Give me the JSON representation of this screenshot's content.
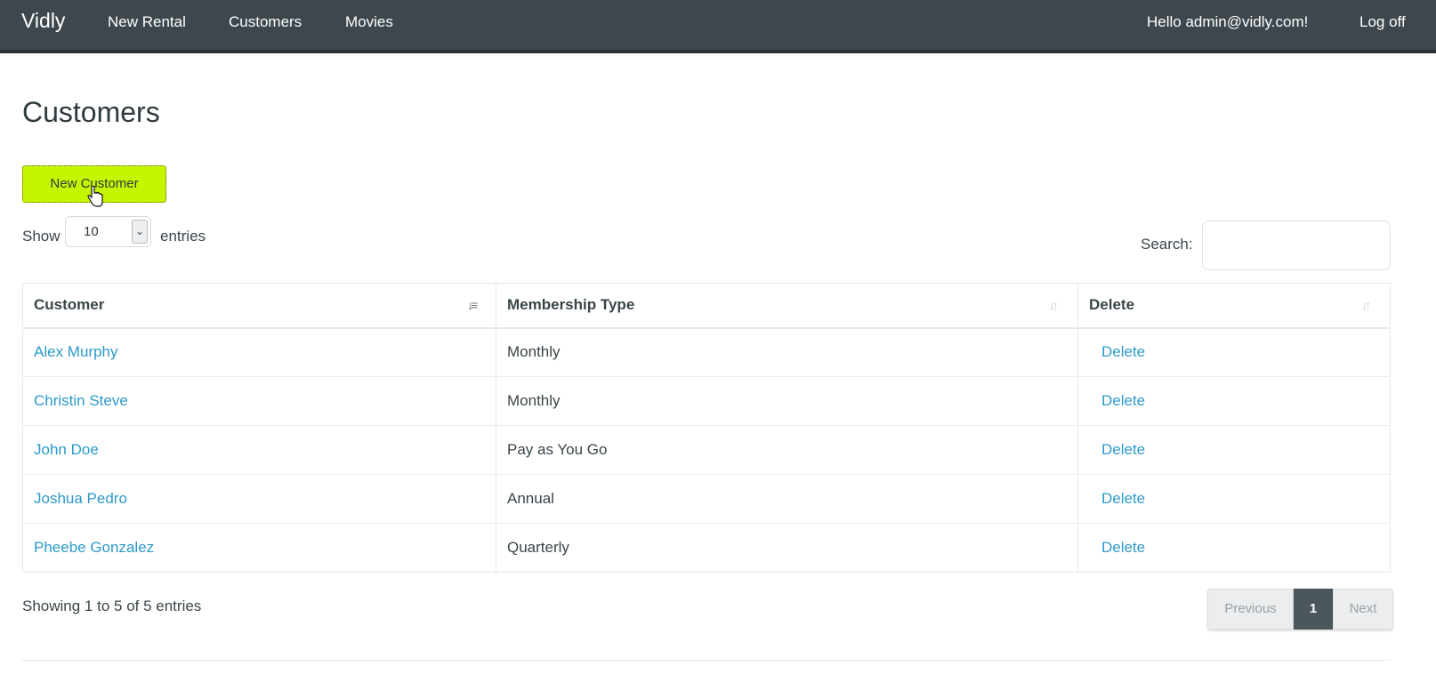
{
  "navbar": {
    "brand": "Vidly",
    "links": [
      "New Rental",
      "Customers",
      "Movies"
    ],
    "greeting": "Hello admin@vidly.com!",
    "logoff": "Log off"
  },
  "page": {
    "title": "Customers",
    "new_button": "New Customer"
  },
  "length": {
    "show_label": "Show",
    "selected": "10",
    "entries_label": "entries"
  },
  "search": {
    "label": "Search:",
    "value": ""
  },
  "table": {
    "headers": [
      "Customer",
      "Membership Type",
      "Delete"
    ],
    "rows": [
      {
        "customer": "Alex Murphy",
        "membership": "Monthly",
        "action": "Delete"
      },
      {
        "customer": "Christin Steve",
        "membership": "Monthly",
        "action": "Delete"
      },
      {
        "customer": "John Doe",
        "membership": "Pay as You Go",
        "action": "Delete"
      },
      {
        "customer": "Joshua Pedro",
        "membership": "Annual",
        "action": "Delete"
      },
      {
        "customer": "Pheebe Gonzalez",
        "membership": "Quarterly",
        "action": "Delete"
      }
    ]
  },
  "footer": {
    "info": "Showing 1 to 5 of 5 entries",
    "previous": "Previous",
    "current_page": "1",
    "next": "Next"
  },
  "colors": {
    "navbar": "#3e474d",
    "accent_button": "#c6f500",
    "link": "#2c9ac9",
    "active_page": "#4a565c"
  },
  "icons": {
    "customer_sort": "sort-ascending-icon",
    "membership_sort": "sort-both-icon",
    "delete_sort": "sort-both-icon",
    "select_caret": "chevron-down-icon",
    "cursor": "hand-pointer-icon"
  }
}
